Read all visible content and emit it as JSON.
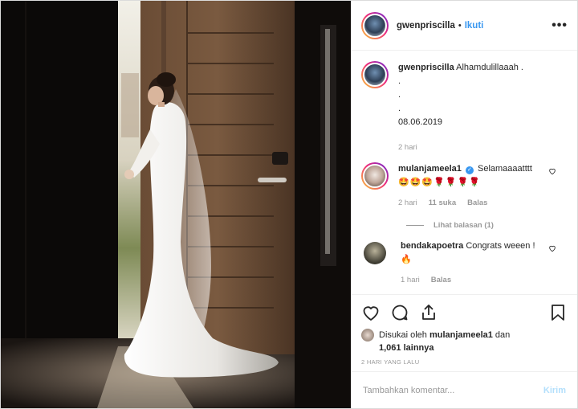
{
  "post": {
    "username": "gwenpriscilla",
    "dot": "•",
    "follow_label": "Ikuti",
    "more_label": "•••"
  },
  "caption": {
    "username": "gwenpriscilla",
    "text": "Alhamdulillaaah .\n.\n.\n.\n08.06.2019",
    "time": "2 hari"
  },
  "comments": [
    {
      "username": "mulanjameela1",
      "verified": "✓",
      "text": "Selamaaaatttt",
      "emojis": "🤩🤩🤩🌹🌹🌹🌹",
      "time": "2 hari",
      "likes": "11 suka",
      "reply_label": "Balas",
      "view_replies": "Lihat balasan (1)"
    },
    {
      "username": "bendakapoetra",
      "text": "Congrats weeen !",
      "emojis": "🔥",
      "time": "1 hari",
      "reply_label": "Balas"
    }
  ],
  "likes": {
    "prefix": "Disukai oleh",
    "user": "mulanjameela1",
    "and": "dan",
    "others": "1,061 lainnya"
  },
  "post_date": "2 HARI YANG LALU",
  "add_comment": {
    "placeholder": "Tambahkan komentar...",
    "post_label": "Kirim"
  },
  "icons": [
    "heart-icon",
    "comment-icon",
    "share-icon",
    "bookmark-icon",
    "more-icon"
  ],
  "colors": {
    "accent": "#3897f0",
    "muted": "#999999",
    "disabled_post": "#b2dffc"
  }
}
